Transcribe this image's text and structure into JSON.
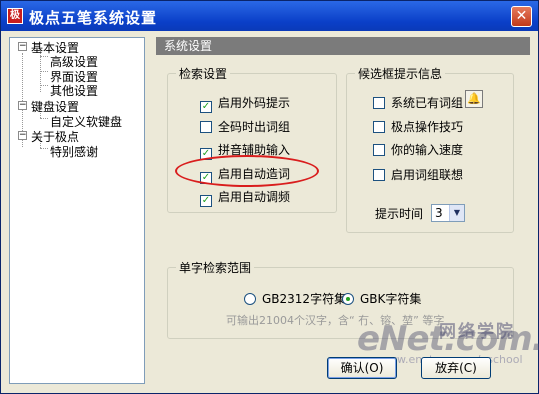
{
  "window": {
    "title": "极点五笔系统设置",
    "app_icon_glyph": "极"
  },
  "tree": {
    "items": [
      {
        "label": "基本设置",
        "toggle": "−"
      },
      {
        "label": "高级设置"
      },
      {
        "label": "界面设置"
      },
      {
        "label": "其他设置"
      },
      {
        "label": "键盘设置",
        "toggle": "−"
      },
      {
        "label": "自定义软键盘"
      },
      {
        "label": "关于极点",
        "toggle": "−"
      },
      {
        "label": "特别感谢"
      }
    ]
  },
  "panel": {
    "title": "系统设置"
  },
  "search_settings": {
    "title": "检索设置",
    "options": [
      {
        "label": "启用外码提示",
        "checked": true
      },
      {
        "label": "全码时出词组",
        "checked": false
      },
      {
        "label": "拼音辅助输入",
        "checked": true
      },
      {
        "label": "启用自动造词",
        "checked": true
      },
      {
        "label": "启用自动调频",
        "checked": true
      }
    ]
  },
  "candidate": {
    "title": "候选框提示信息",
    "options": [
      {
        "label": "系统已有词组",
        "checked": false
      },
      {
        "label": "极点操作技巧",
        "checked": false
      },
      {
        "label": "你的输入速度",
        "checked": false
      },
      {
        "label": "启用词组联想",
        "checked": false
      }
    ],
    "hint_time_label": "提示时间",
    "hint_time_value": "3"
  },
  "single_char": {
    "title": "单字检索范围",
    "options": [
      {
        "label": "GB2312字符集",
        "selected": false
      },
      {
        "label": "GBK字符集",
        "selected": true
      }
    ],
    "hint": "可输出21004个汉字，含“ 冇、镕、堃” 等字"
  },
  "buttons": {
    "confirm": "确认(O)",
    "cancel": "放弃(C)"
  },
  "watermark": {
    "logo": "eNet.com.cn",
    "cn": "网络学院",
    "url": "www.enet.com.cn/eschool"
  },
  "colors": {
    "titlebar": "#0a3fc8",
    "highlight_ellipse": "#d91d1d"
  }
}
